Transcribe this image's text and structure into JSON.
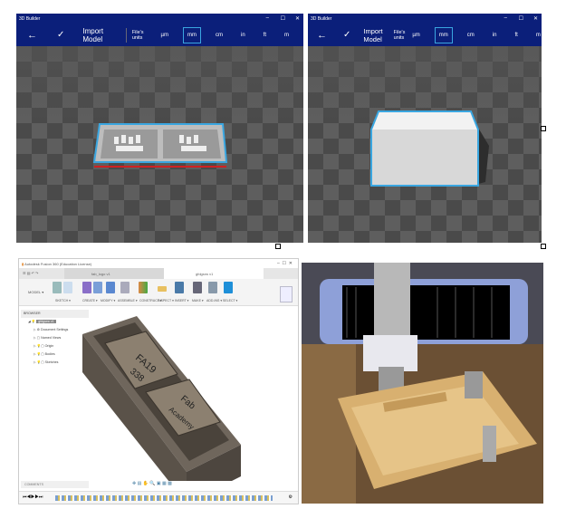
{
  "builder_left": {
    "app_title": "3D Builder",
    "back_icon": "arrow-left",
    "confirm_icon": "check",
    "title": "Import Model",
    "units_label": "File's units",
    "units": [
      "µm",
      "mm",
      "cm",
      "in",
      "ft",
      "m"
    ],
    "selected_unit": "mm",
    "window_controls": [
      "–",
      "☐",
      "✕"
    ]
  },
  "builder_right": {
    "app_title": "3D Builder",
    "title": "Import Model",
    "units_label": "File's units",
    "units": [
      "µm",
      "mm",
      "cm",
      "in",
      "ft",
      "m"
    ],
    "selected_unit": "mm",
    "window_controls": [
      "–",
      "☐",
      "✕"
    ]
  },
  "fusion": {
    "app_title": "Autodesk Fusion 360 (Education License)",
    "tabs": [
      "fab_logo v1",
      "gfdgsrw v1"
    ],
    "workspace": "MODEL ▾",
    "toolbar_groups": [
      "SKETCH ▾",
      "CREATE ▾",
      "MODIFY ▾",
      "ASSEMBLE ▾",
      "CONSTRUCT ▾",
      "INSPECT ▾",
      "INSERT ▾",
      "MAKE ▾",
      "ADD-INS ▾",
      "SELECT ▾"
    ],
    "browser_title": "BROWSER",
    "root": "gfdgsrw v1",
    "browser_items": [
      "Document Settings",
      "Named Views",
      "Origin",
      "Bodies",
      "Sketches"
    ],
    "model_text_1": "FA19",
    "model_text_2": "338",
    "model_text_3": "Fab",
    "model_text_4": "Academy",
    "comments_label": "COMMENTS",
    "timeline_controls": [
      "⏮",
      "◀",
      "▶",
      "▶",
      "⏭"
    ]
  },
  "colors": {
    "builder_header": "#0b1f7a",
    "selection": "#3aa6e0"
  }
}
